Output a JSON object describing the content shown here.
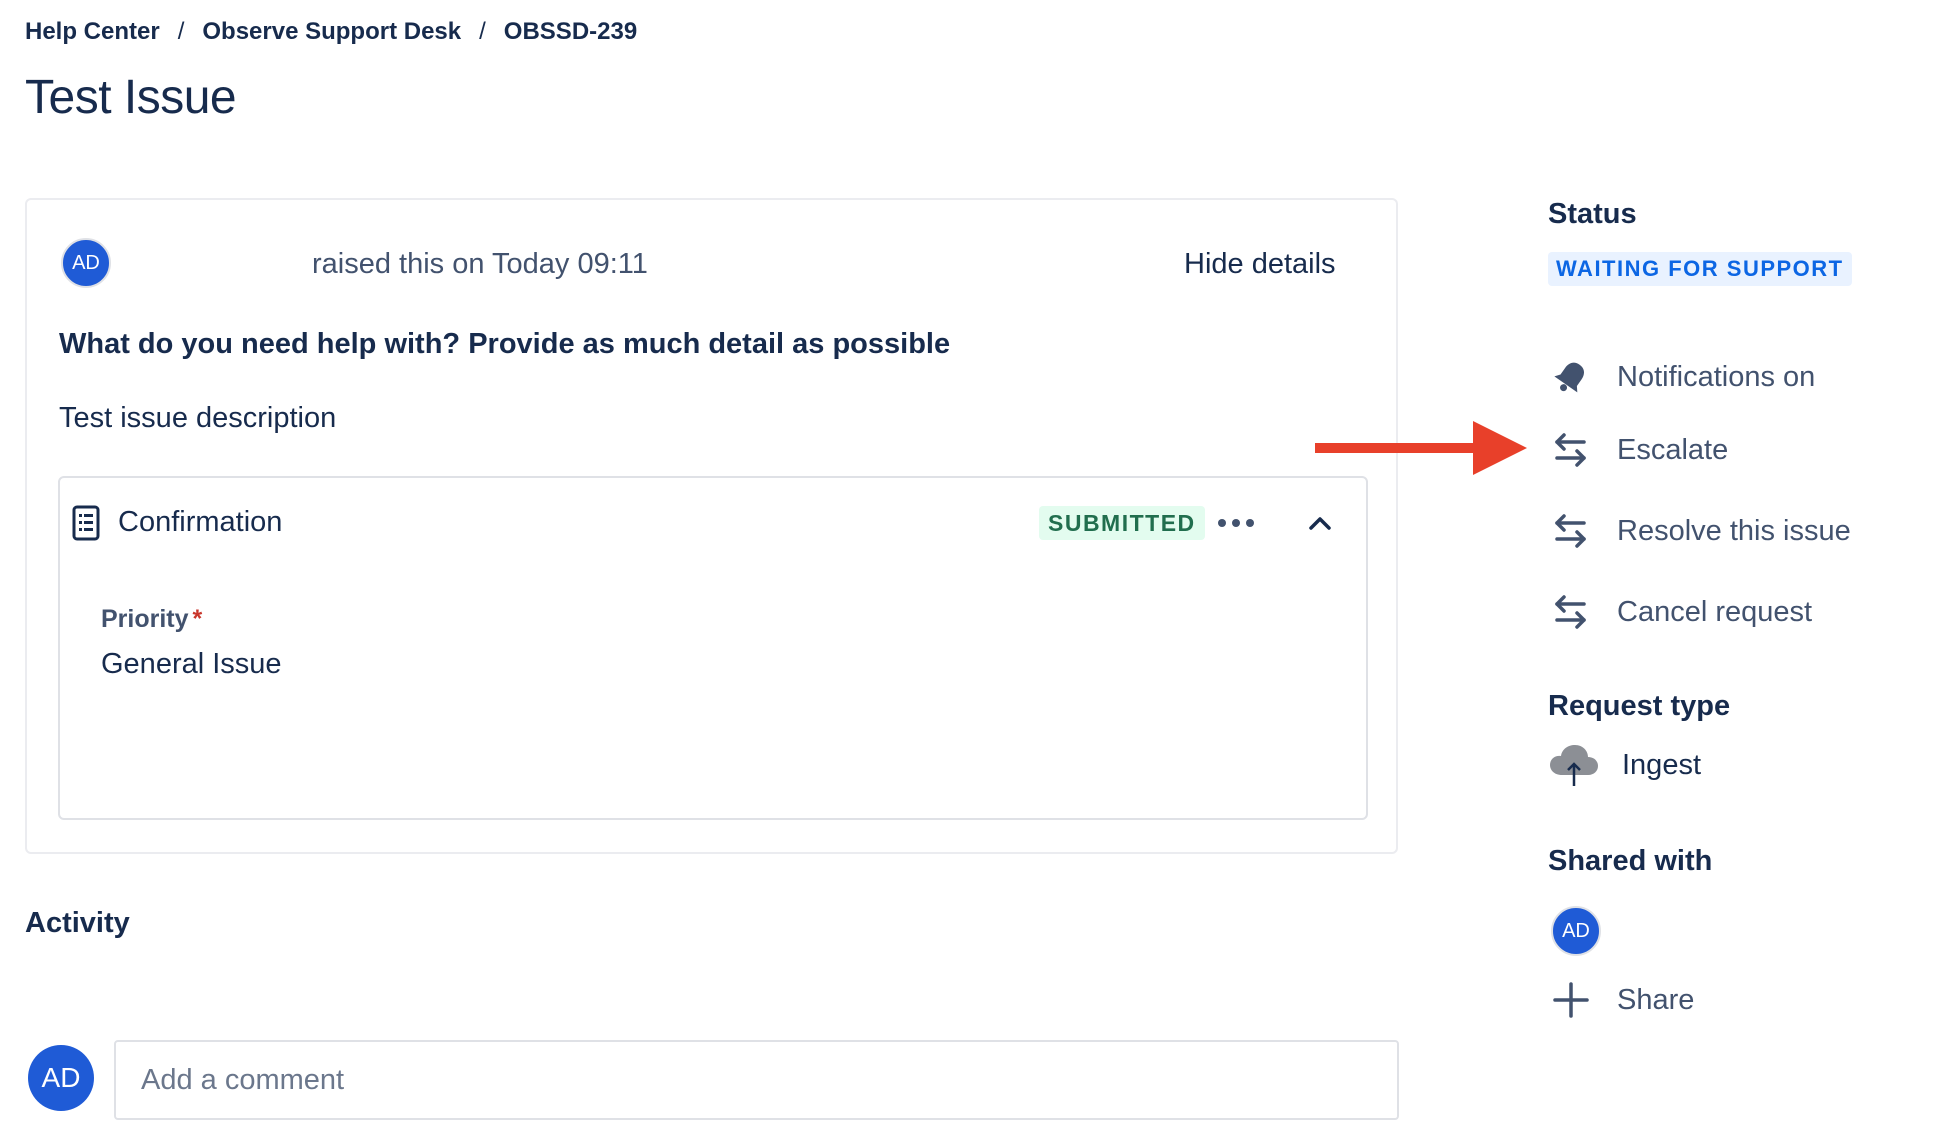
{
  "breadcrumb": {
    "items": [
      "Help Center",
      "Observe Support Desk",
      "OBSSD-239"
    ],
    "separator": "/"
  },
  "page_title": "Test Issue",
  "request": {
    "reporter_initials": "AD",
    "raised_text": "raised this on Today 09:11",
    "hide_details_label": "Hide details",
    "question": "What do you need help with? Provide as much detail as possible",
    "description": "Test issue description",
    "form": {
      "title": "Confirmation",
      "status": "SUBMITTED",
      "status_color": "#216e4e",
      "fields": [
        {
          "label": "Priority",
          "required_marker": "*",
          "value": "General Issue"
        }
      ]
    }
  },
  "activity": {
    "title": "Activity",
    "user_initials": "AD",
    "comment_placeholder": "Add a comment"
  },
  "sidebar": {
    "status_heading": "Status",
    "status_value": "WAITING FOR SUPPORT",
    "status_color": "#0c66e4",
    "actions": [
      {
        "label": "Notifications on",
        "icon": "bell-icon"
      },
      {
        "label": "Escalate",
        "icon": "transition-icon"
      },
      {
        "label": "Resolve this issue",
        "icon": "transition-icon"
      },
      {
        "label": "Cancel request",
        "icon": "transition-icon"
      }
    ],
    "request_type_heading": "Request type",
    "request_type_value": "Ingest",
    "request_type_icon": "cloud-upload-icon",
    "shared_with_heading": "Shared with",
    "shared_user_initials": "AD",
    "share_label": "Share"
  },
  "annotation": {
    "arrow_color": "#e8402a",
    "points_to": "Escalate"
  }
}
